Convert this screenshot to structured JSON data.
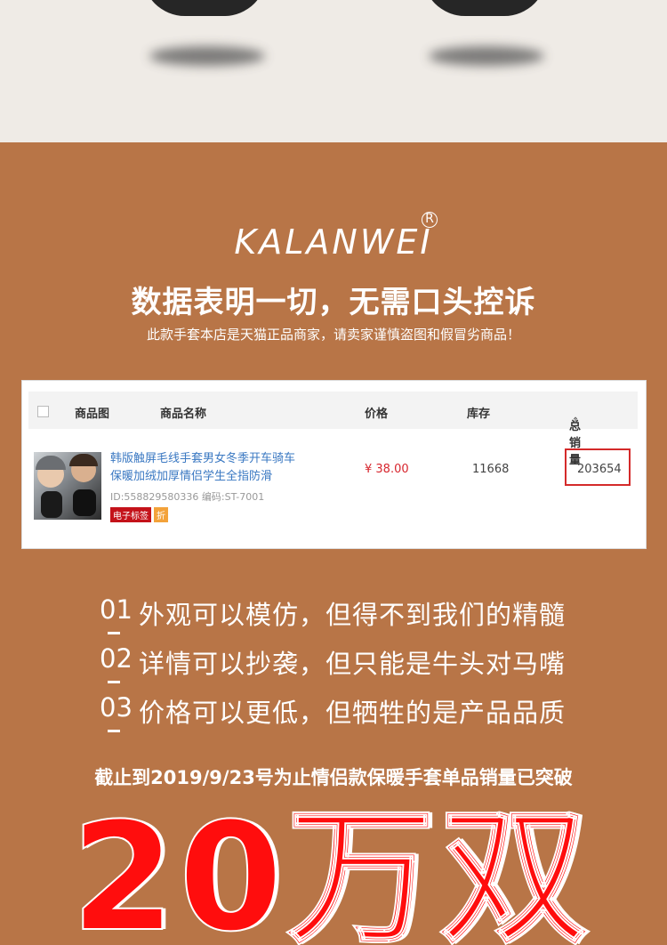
{
  "brand": {
    "logo_text": "KALANWEI",
    "reg_mark": "R"
  },
  "headline": "数据表明一切，无需口头控诉",
  "subline": "此款手套本店是天猫正品商家，请卖家谨慎盗图和假冒劣商品！",
  "table": {
    "headers": {
      "image": "商品图",
      "name": "商品名称",
      "price": "价格",
      "stock": "库存",
      "total_sales": "总销量",
      "sort_icon": "sort-icon"
    },
    "row": {
      "name_line1": "韩版触屏毛线手套男女冬季开车骑车",
      "name_line2": "保暖加绒加厚情侣学生全指防滑",
      "id_code": "ID:558829580336 编码:ST-7001",
      "tag_red": "电子标签",
      "tag_orange": "折",
      "price": "¥ 38.00",
      "stock": "11668",
      "total_sales": "203654"
    }
  },
  "claims": [
    {
      "num": "01",
      "text": "外观可以模仿，但得不到我们的精髓"
    },
    {
      "num": "02",
      "text": "详情可以抄袭，但只能是牛头对马嘴"
    },
    {
      "num": "03",
      "text": "价格可以更低，但牺牲的是产品品质"
    }
  ],
  "note": "截止到2019/9/23号为止情侣款保暖手套单品销量已突破",
  "big_text": "20万双",
  "colors": {
    "background": "#b87547",
    "accent_red": "#ff0d0d",
    "top_strip": "#efebe6"
  }
}
